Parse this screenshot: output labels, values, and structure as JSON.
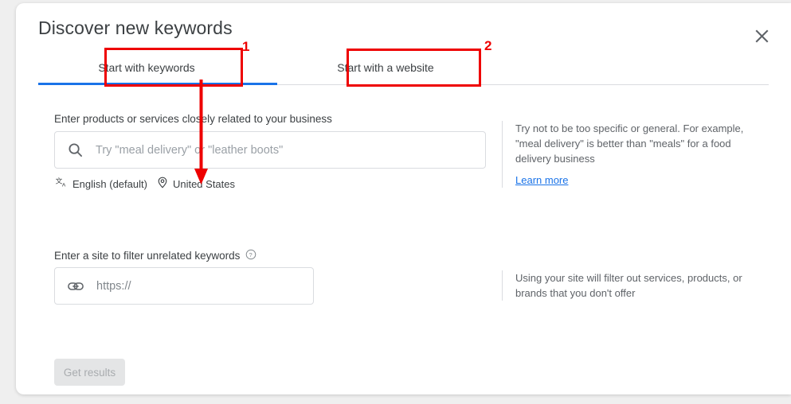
{
  "dialog": {
    "title": "Discover new keywords",
    "close_icon": "close-icon"
  },
  "tabs": [
    {
      "label": "Start with keywords",
      "active": true
    },
    {
      "label": "Start with a website",
      "active": false
    }
  ],
  "keywords_section": {
    "label": "Enter products or services closely related to your business",
    "input_placeholder": "Try \"meal delivery\" or \"leather boots\"",
    "input_value": "",
    "search_icon": "search-icon",
    "language_icon": "translate-icon",
    "language_value": "English (default)",
    "location_icon": "location-pin-icon",
    "location_value": "United States",
    "helper_text": "Try not to be too specific or general. For example, \"meal delivery\" is better than \"meals\" for a food delivery business",
    "learn_more_label": "Learn more"
  },
  "site_section": {
    "label": "Enter a site to filter unrelated keywords",
    "help_icon": "help-circle-icon",
    "input_placeholder": "https://",
    "input_value": "",
    "link_icon": "link-icon",
    "helper_text": "Using your site will filter out services, products, or brands that you don't offer"
  },
  "actions": {
    "submit_label": "Get results",
    "submit_disabled": true
  },
  "annotations": {
    "color": "#ee0000",
    "marker_1": "1",
    "marker_2": "2"
  },
  "colors": {
    "accent_blue": "#1a73e8",
    "text_primary": "#3c4043",
    "text_secondary": "#5f6368",
    "border": "#dadce0",
    "annotation_red": "#ee0000",
    "disabled_button_bg": "#e4e5e6"
  }
}
